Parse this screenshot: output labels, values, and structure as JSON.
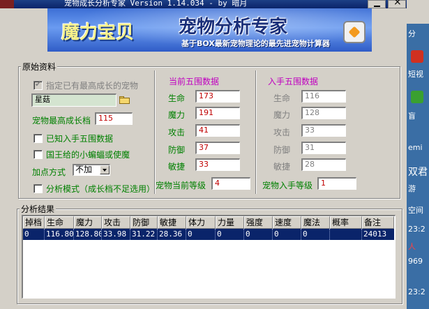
{
  "window": {
    "title": "宠物成长分析专家 Version 1.14.034 - by 暗月"
  },
  "banner": {
    "brand": "魔力宝贝",
    "title": "宠物分析专家",
    "subtitle": "基于BOX最新宠物理论的最先进宠物计算器"
  },
  "raw": {
    "legend": "原始资料",
    "specify_label": "指定已有最高成长的宠物",
    "pet_name": "星菇",
    "max_growth_label": "宠物最高成长档",
    "max_growth_value": "115",
    "known_stats_label": "已知入手五围数据",
    "king_bat_label": "国王给的小蝙蝠或使魔",
    "add_points_label": "加点方式",
    "add_points_value": "不加",
    "analysis_mode_label": "分析模式（成长档不足选用）"
  },
  "current": {
    "header": "当前五围数据",
    "stats": [
      {
        "label": "生命",
        "value": "173"
      },
      {
        "label": "魔力",
        "value": "191"
      },
      {
        "label": "攻击",
        "value": "41"
      },
      {
        "label": "防御",
        "value": "37"
      },
      {
        "label": "敏捷",
        "value": "33"
      }
    ],
    "level_label": "宠物当前等级",
    "level_value": "4"
  },
  "obtained": {
    "header": "入手五围数据",
    "stats": [
      {
        "label": "生命",
        "value": "116"
      },
      {
        "label": "魔力",
        "value": "128"
      },
      {
        "label": "攻击",
        "value": "33"
      },
      {
        "label": "防御",
        "value": "31"
      },
      {
        "label": "敏捷",
        "value": "28"
      }
    ],
    "level_label": "宠物入手等级",
    "level_value": "1"
  },
  "results": {
    "legend": "分析结果",
    "columns": [
      "掉档",
      "生命",
      "魔力",
      "攻击",
      "防御",
      "敏捷",
      "体力",
      "力量",
      "强度",
      "速度",
      "魔法",
      "概率",
      "备注"
    ],
    "rows": [
      [
        "0",
        "116.80",
        "128.80",
        "33.98",
        "31.22",
        "28.36",
        "0",
        "0",
        "0",
        "0",
        "0",
        "",
        "24013"
      ]
    ]
  },
  "desktop": {
    "items": [
      "分",
      "短视",
      "盲",
      "emi",
      "双君",
      "游",
      "空间",
      "23:2",
      "人",
      "969",
      "23:2"
    ]
  },
  "colors": {
    "titlebar": "#0a246a",
    "selection": "#0a246a",
    "label_green": "#008000",
    "header_magenta": "#c000c0",
    "value_red": "#c00000"
  }
}
